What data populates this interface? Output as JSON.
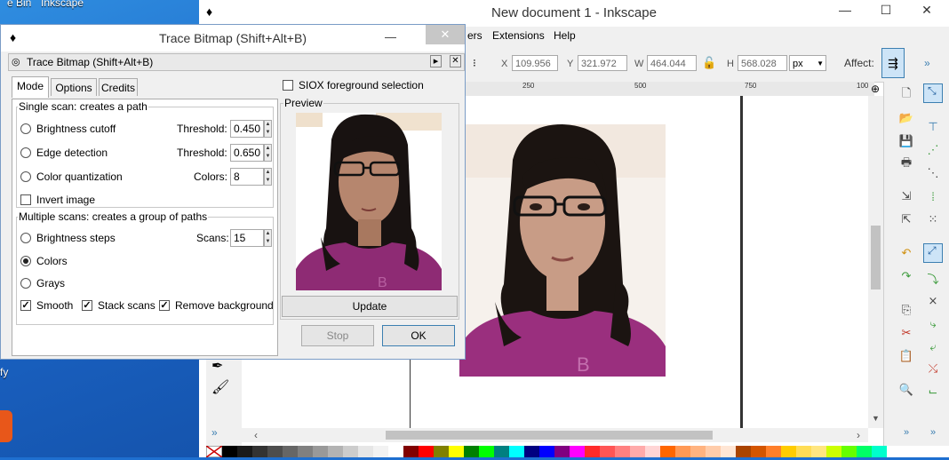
{
  "desktop": {
    "label_top_left": "e Bin",
    "label_top_right": "Inkscape",
    "label_side": "fy"
  },
  "main_window": {
    "title": "New document 1 - Inkscape",
    "controls": {
      "minimize": "—",
      "maximize": "☐",
      "close": "✕"
    },
    "menu": {
      "partial": "ers",
      "items": [
        "Extensions",
        "Help"
      ]
    },
    "toolbar": {
      "x_label": "X",
      "x_value": "109.956",
      "y_label": "Y",
      "y_value": "321.972",
      "w_label": "W",
      "w_value": "464.044",
      "h_label": "H",
      "h_value": "568.028",
      "unit": "px",
      "affect_label": "Affect:",
      "more": "»"
    },
    "ruler_ticks": [
      "250",
      "500",
      "750",
      "100"
    ],
    "more_tools": "»"
  },
  "dialog": {
    "window_title": "Trace Bitmap (Shift+Alt+B)",
    "panel_title": "Trace Bitmap (Shift+Alt+B)",
    "tabs": [
      "Mode",
      "Options",
      "Credits"
    ],
    "active_tab": "Mode",
    "single_scan": {
      "legend": "Single scan: creates a path",
      "brightness_cutoff": {
        "label": "Brightness cutoff",
        "param_label": "Threshold:",
        "value": "0.450"
      },
      "edge_detection": {
        "label": "Edge detection",
        "param_label": "Threshold:",
        "value": "0.650"
      },
      "color_quantization": {
        "label": "Color quantization",
        "param_label": "Colors:",
        "value": "8"
      },
      "invert_image": "Invert image"
    },
    "multiple_scans": {
      "legend": "Multiple scans: creates a group of paths",
      "brightness_steps": {
        "label": "Brightness steps",
        "param_label": "Scans:",
        "value": "15"
      },
      "colors": "Colors",
      "grays": "Grays",
      "smooth": "Smooth",
      "stack_scans": "Stack scans",
      "remove_background": "Remove background",
      "selected": "Colors"
    },
    "siox": "SIOX foreground selection",
    "preview_label": "Preview",
    "update_button": "Update",
    "stop_button": "Stop",
    "ok_button": "OK"
  },
  "colors": {
    "accent_blue": "#3c7fb1",
    "shirt_magenta": "#9a2f7e",
    "hair": "#1a1210",
    "skin": "#c89c86"
  }
}
